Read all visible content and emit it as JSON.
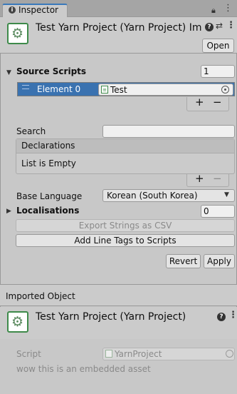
{
  "tab": {
    "label": "Inspector",
    "icon": "info-icon"
  },
  "header": {
    "title": "Test Yarn Project (Yarn Project) Impo",
    "help": "?",
    "settings": "⇄",
    "more": "⋮",
    "open_button": "Open"
  },
  "source_scripts": {
    "label": "Source Scripts",
    "count": "1",
    "element_label": "Element 0",
    "element_value": "Test",
    "add": "+",
    "remove": "−"
  },
  "search": {
    "label": "Search",
    "value": ""
  },
  "declarations": {
    "header": "Declarations",
    "empty_text": "List is Empty",
    "add": "+",
    "remove": "−"
  },
  "base_language": {
    "label": "Base Language",
    "value": "Korean (South Korea)"
  },
  "localisations": {
    "label": "Localisations",
    "count": "0"
  },
  "buttons": {
    "export_strings": "Export Strings as CSV",
    "add_line_tags": "Add Line Tags to Scripts",
    "revert": "Revert",
    "apply": "Apply"
  },
  "imported": {
    "section_label": "Imported Object",
    "title": "Test Yarn Project (Yarn Project)",
    "help": "?",
    "more": "⋮",
    "script_label": "Script",
    "script_value": "YarnProject",
    "note": "wow this is an embedded asset"
  },
  "colors": {
    "accent": "#3a72b0",
    "selection": "#3a72b0",
    "yarn_icon_border": "#3e8a4a"
  }
}
